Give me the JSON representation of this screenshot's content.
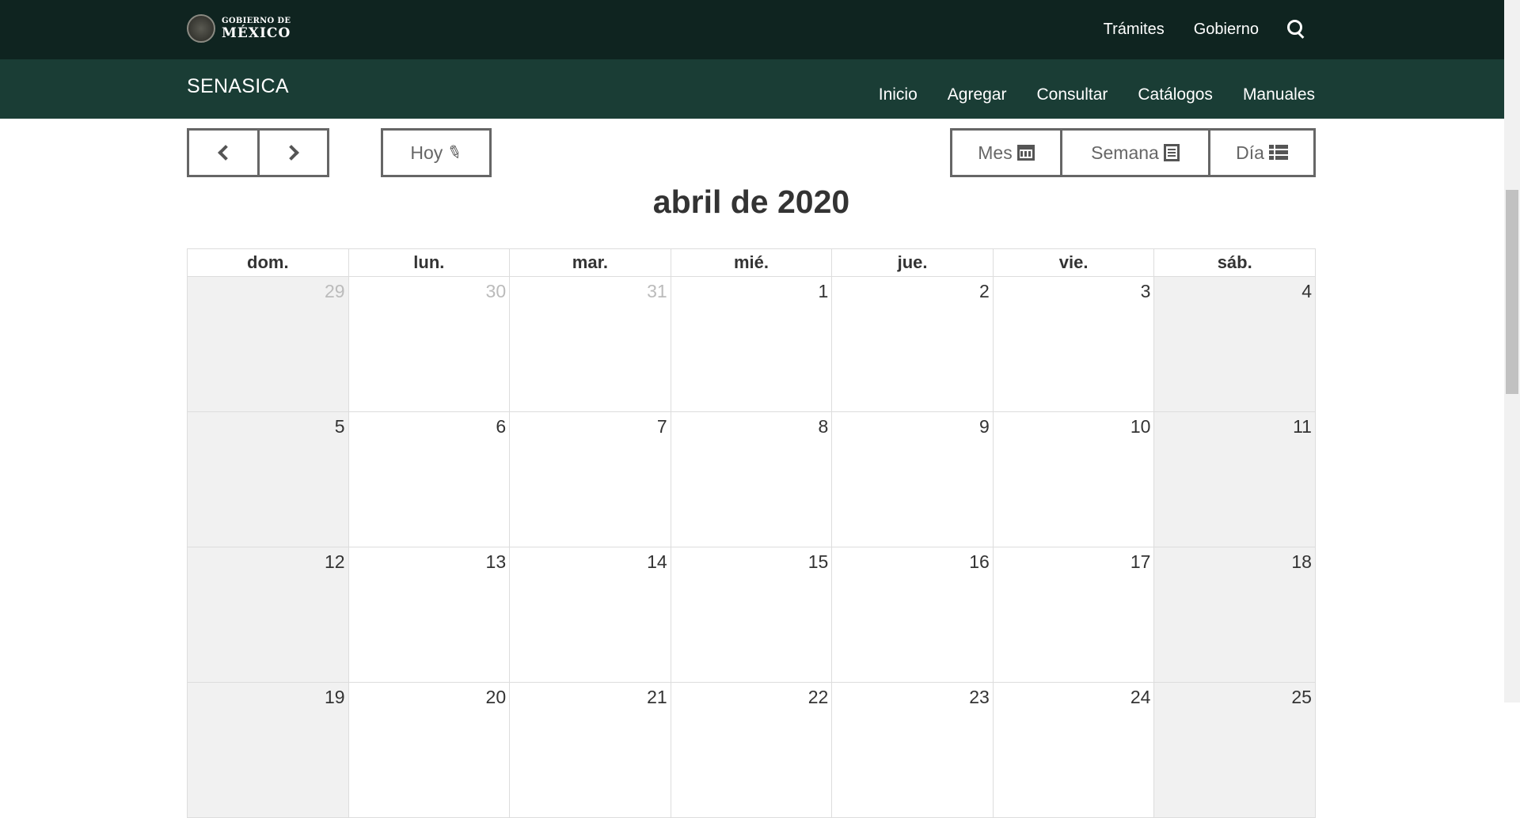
{
  "topbar": {
    "logo_line1": "GOBIERNO DE",
    "logo_line2": "MÉXICO",
    "nav": [
      "Trámites",
      "Gobierno"
    ]
  },
  "subbar": {
    "brand": "SENASICA",
    "nav": [
      "Inicio",
      "Agregar",
      "Consultar",
      "Catálogos",
      "Manuales"
    ]
  },
  "toolbar": {
    "today_label": "Hoy",
    "view_month": "Mes",
    "view_week": "Semana",
    "view_day": "Día",
    "icons": [
      "chevron-left-icon",
      "chevron-right-icon",
      "pin-icon",
      "calendar-icon",
      "list-alt-icon",
      "th-list-icon"
    ]
  },
  "calendar": {
    "title": "abril de 2020",
    "weekdays": [
      "dom.",
      "lun.",
      "mar.",
      "mié.",
      "jue.",
      "vie.",
      "sáb."
    ],
    "weeks": [
      [
        "29",
        "30",
        "31",
        "1",
        "2",
        "3",
        "4"
      ],
      [
        "5",
        "6",
        "7",
        "8",
        "9",
        "10",
        "11"
      ],
      [
        "12",
        "13",
        "14",
        "15",
        "16",
        "17",
        "18"
      ],
      [
        "19",
        "20",
        "21",
        "22",
        "23",
        "24",
        "25"
      ]
    ],
    "other_month_days": [
      "29",
      "30",
      "31"
    ]
  },
  "colors": {
    "topbar_bg": "#0f2420",
    "subbar_bg": "#1a3d35",
    "weekend_bg": "#f1f1f1"
  }
}
